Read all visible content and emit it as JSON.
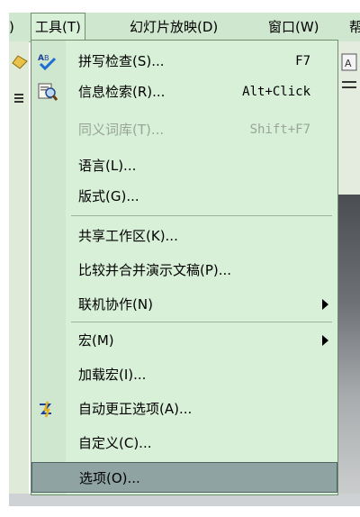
{
  "menubar": {
    "items": [
      {
        "label": ")"
      },
      {
        "label": "工具(T)"
      },
      {
        "label": "幻灯片放映(D)"
      },
      {
        "label": "窗口(W)"
      },
      {
        "label": "帮"
      }
    ]
  },
  "menu": {
    "items": [
      {
        "label": "拼写检查(S)...",
        "shortcut": "F7",
        "icon": "spellcheck-icon"
      },
      {
        "label": "信息检索(R)...",
        "shortcut": "Alt+Click",
        "icon": "research-icon"
      },
      {
        "label": "同义词库(T)...",
        "shortcut": "Shift+F7",
        "disabled": true
      },
      {
        "label": "语言(L)..."
      },
      {
        "label": "版式(G)..."
      },
      {
        "label": "共享工作区(K)..."
      },
      {
        "label": "比较并合并演示文稿(P)..."
      },
      {
        "label": "联机协作(N)",
        "submenu": true
      },
      {
        "label": "宏(M)",
        "submenu": true
      },
      {
        "label": "加载宏(I)..."
      },
      {
        "label": "自动更正选项(A)...",
        "icon": "autocorrect-icon"
      },
      {
        "label": "自定义(C)..."
      },
      {
        "label": "选项(O)...",
        "selected": true
      }
    ]
  },
  "colors": {
    "menu_bg": "#d8efd8",
    "icon_column": "#cfe6cf",
    "highlight": "#8fa3a3",
    "border": "#6f8f6f"
  }
}
